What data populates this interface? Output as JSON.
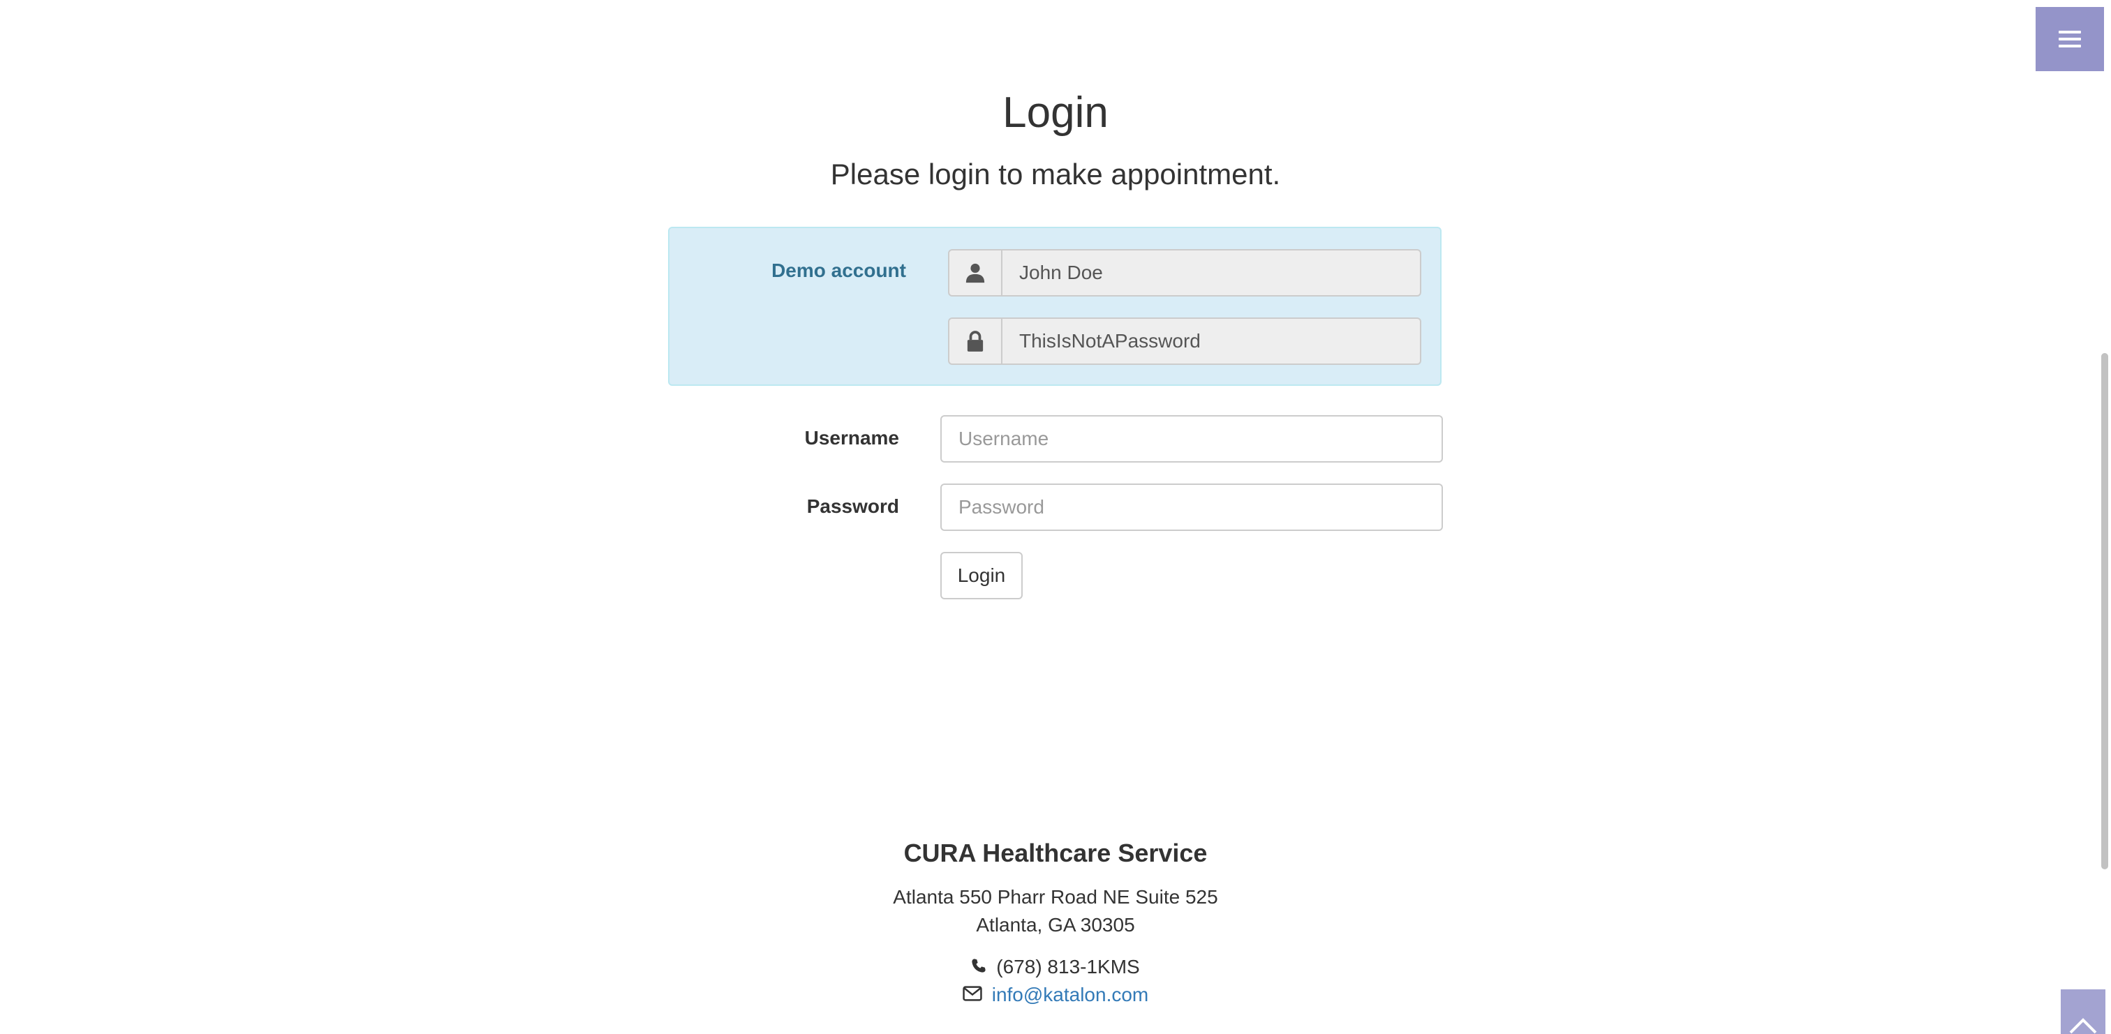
{
  "header": {
    "title": "Login",
    "subtitle": "Please login to make appointment."
  },
  "demo_account": {
    "label": "Demo account",
    "username_value": "John Doe",
    "password_value": "ThisIsNotAPassword"
  },
  "form": {
    "username_label": "Username",
    "username_placeholder": "Username",
    "password_label": "Password",
    "password_placeholder": "Password",
    "login_button": "Login"
  },
  "footer": {
    "title": "CURA Healthcare Service",
    "address_line1": "Atlanta 550 Pharr Road NE Suite 525",
    "address_line2": "Atlanta, GA 30305",
    "phone": "(678) 813-1KMS",
    "email": "info@katalon.com"
  },
  "icons": {
    "menu": "hamburger-menu-icon",
    "user": "user-icon",
    "lock": "lock-icon",
    "phone": "phone-icon",
    "email": "envelope-icon",
    "to_top": "chevron-up-icon"
  },
  "colors": {
    "accent": "#9494c9",
    "demo_panel_bg": "#d9edf7",
    "demo_label": "#31708f",
    "link": "#337ab7"
  }
}
